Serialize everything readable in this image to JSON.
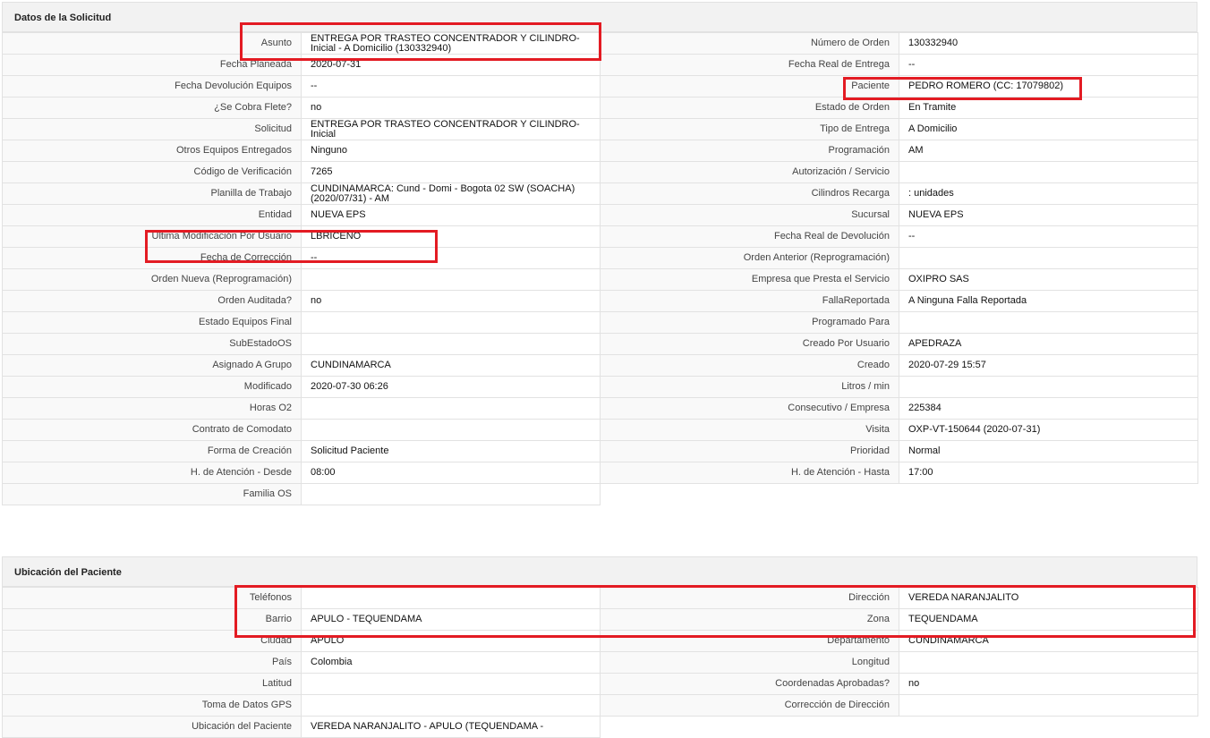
{
  "sections": [
    {
      "title": "Datos de la Solicitud",
      "rows": [
        [
          "Asunto",
          "ENTREGA POR TRASTEO CONCENTRADOR Y CILINDRO-Inicial - A Domicilio (130332940)",
          "Número de Orden",
          "130332940"
        ],
        [
          "Fecha Planeada",
          "2020-07-31",
          "Fecha Real de Entrega",
          "--"
        ],
        [
          "Fecha Devolución Equipos",
          "--",
          "Paciente",
          "PEDRO ROMERO (CC: 17079802)"
        ],
        [
          "¿Se Cobra Flete?",
          "no",
          "Estado de Orden",
          "En Tramite"
        ],
        [
          "Solicitud",
          "ENTREGA POR TRASTEO CONCENTRADOR Y CILINDRO-Inicial",
          "Tipo de Entrega",
          "A Domicilio"
        ],
        [
          "Otros Equipos Entregados",
          "Ninguno",
          "Programación",
          "AM"
        ],
        [
          "Código de Verificación",
          "7265",
          "Autorización / Servicio",
          ""
        ],
        [
          "Planilla de Trabajo",
          "CUNDINAMARCA: Cund - Domi - Bogota 02 SW (SOACHA) (2020/07/31) - AM",
          "Cilindros Recarga",
          ": unidades"
        ],
        [
          "Entidad",
          "NUEVA EPS",
          "Sucursal",
          "NUEVA EPS"
        ],
        [
          "Ultima Modificación Por Usuario",
          "LBRICENO",
          "Fecha Real de Devolución",
          "--"
        ],
        [
          "Fecha de Corrección",
          "--",
          "Orden Anterior (Reprogramación)",
          ""
        ],
        [
          "Orden Nueva (Reprogramación)",
          "",
          "Empresa que Presta el Servicio",
          "OXIPRO SAS"
        ],
        [
          "Orden Auditada?",
          "no",
          "FallaReportada",
          "A Ninguna Falla Reportada"
        ],
        [
          "Estado Equipos Final",
          "",
          "Programado Para",
          ""
        ],
        [
          "SubEstadoOS",
          "",
          "Creado Por Usuario",
          "APEDRAZA"
        ],
        [
          "Asignado A Grupo",
          "CUNDINAMARCA",
          "Creado",
          "2020-07-29 15:57"
        ],
        [
          "Modificado",
          "2020-07-30 06:26",
          "Litros / min",
          ""
        ],
        [
          "Horas O2",
          "",
          "Consecutivo / Empresa",
          "225384"
        ],
        [
          "Contrato de Comodato",
          "",
          "Visita",
          "OXP-VT-150644 (2020-07-31)"
        ],
        [
          "Forma de Creación",
          "Solicitud Paciente",
          "Prioridad",
          "Normal"
        ],
        [
          "H. de Atención - Desde",
          "08:00",
          "H. de Atención - Hasta",
          "17:00"
        ],
        [
          "Familia OS",
          ""
        ]
      ]
    },
    {
      "title": "Ubicación del Paciente",
      "rows": [
        [
          "Teléfonos",
          "",
          "Dirección",
          "VEREDA NARANJALITO"
        ],
        [
          "Barrio",
          "APULO - TEQUENDAMA",
          "Zona",
          "TEQUENDAMA"
        ],
        [
          "Ciudad",
          "APULO",
          "Departamento",
          "CUNDINAMARCA"
        ],
        [
          "País",
          "Colombia",
          "Longitud",
          ""
        ],
        [
          "Latitud",
          "",
          "Coordenadas Aprobadas?",
          "no"
        ],
        [
          "Toma de Datos GPS",
          "",
          "Corrección de Dirección",
          ""
        ],
        [
          "Ubicación del Paciente",
          "VEREDA NARANJALITO - APULO (TEQUENDAMA -"
        ]
      ]
    }
  ],
  "highlight_color": "#e31b23"
}
